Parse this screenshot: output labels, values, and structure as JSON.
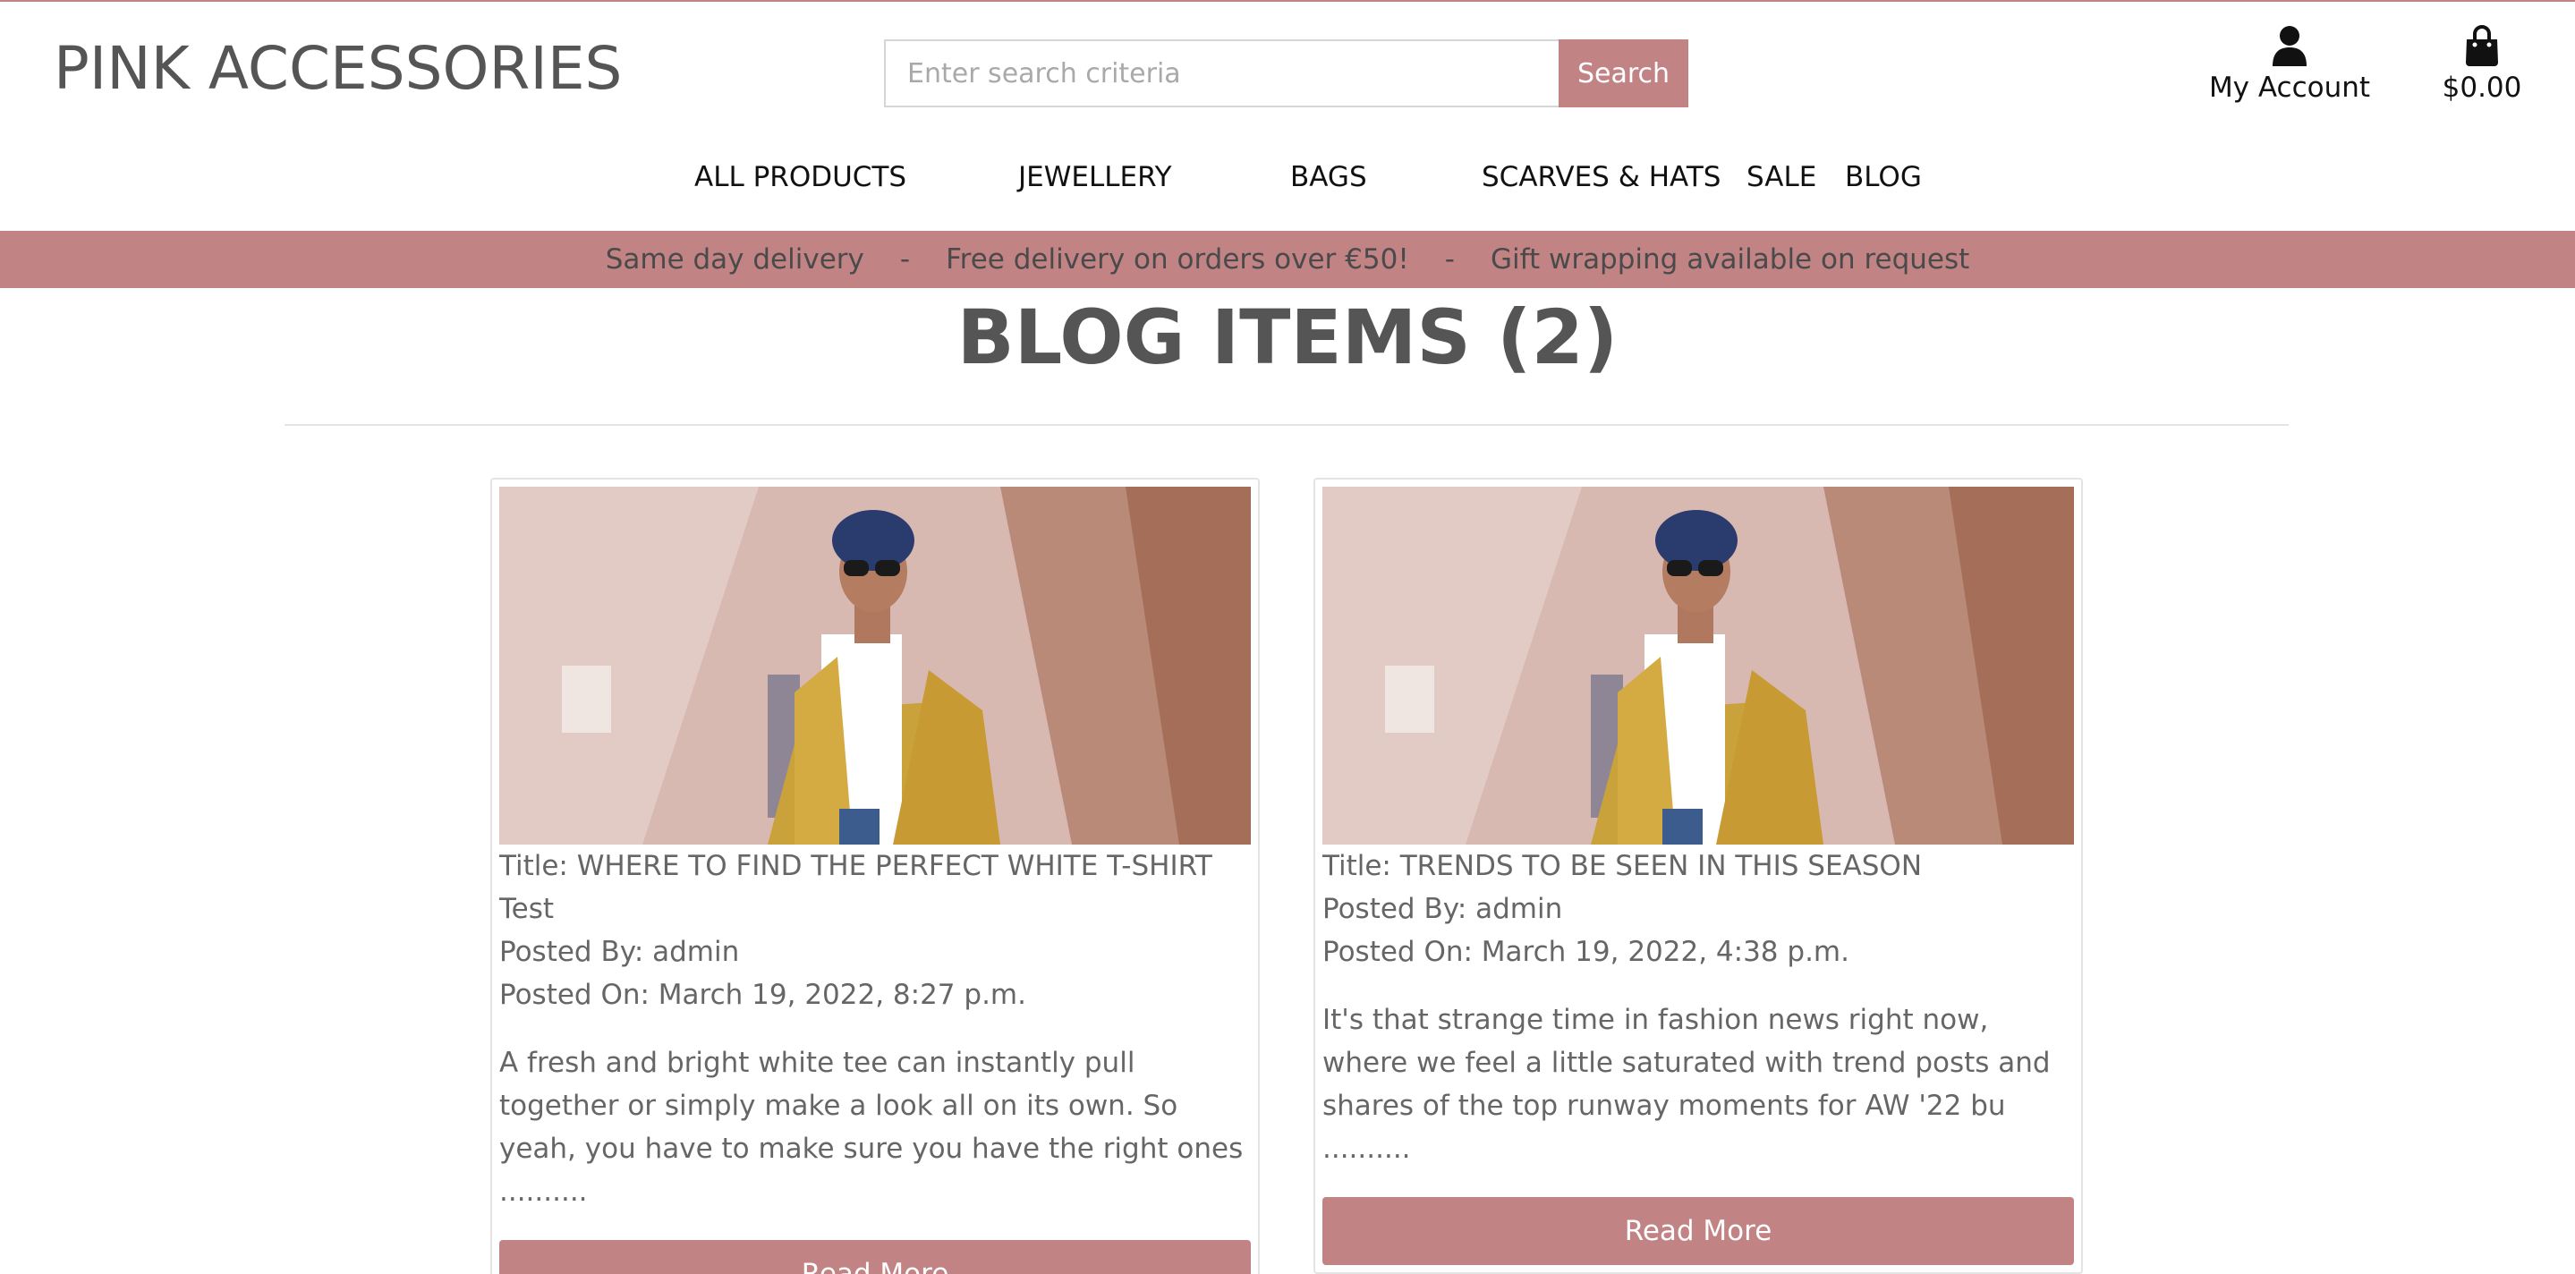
{
  "brand": {
    "logo": "PINK ACCESSORIES",
    "accent": "#c28385"
  },
  "search": {
    "placeholder": "Enter search criteria",
    "button": "Search"
  },
  "account": {
    "label": "My Account",
    "icon": "user-icon"
  },
  "cart": {
    "total": "$0.00",
    "icon": "shopping-bag-icon"
  },
  "nav": [
    "ALL PRODUCTS",
    "JEWELLERY",
    "BAGS",
    "SCARVES & HATS",
    "SALE",
    "BLOG"
  ],
  "banner": {
    "items": [
      "Same day delivery",
      "Free delivery on orders over €50!",
      "Gift wrapping available on request"
    ],
    "separator": "-"
  },
  "page_title": "BLOG ITEMS (2)",
  "posts": [
    {
      "title_line1": "Title: WHERE TO FIND THE PERFECT WHITE T-SHIRT",
      "title_line2": "Test",
      "posted_by": "Posted By: admin",
      "posted_on": "Posted On: March 19, 2022, 8:27 p.m.",
      "excerpt": "A fresh and bright white tee can instantly pull together or simply make a look all on its own. So yeah, you have to make sure you have the right ones ..........",
      "button": "Read More"
    },
    {
      "title_line1": "Title: TRENDS TO BE SEEN IN THIS SEASON",
      "posted_by": "Posted By: admin",
      "posted_on": "Posted On: March 19, 2022, 4:38 p.m.",
      "excerpt": "It's that strange time in fashion news right now, where we feel a little saturated with trend posts and shares of the top runway moments for AW '22 bu ..........",
      "button": "Read More"
    }
  ]
}
